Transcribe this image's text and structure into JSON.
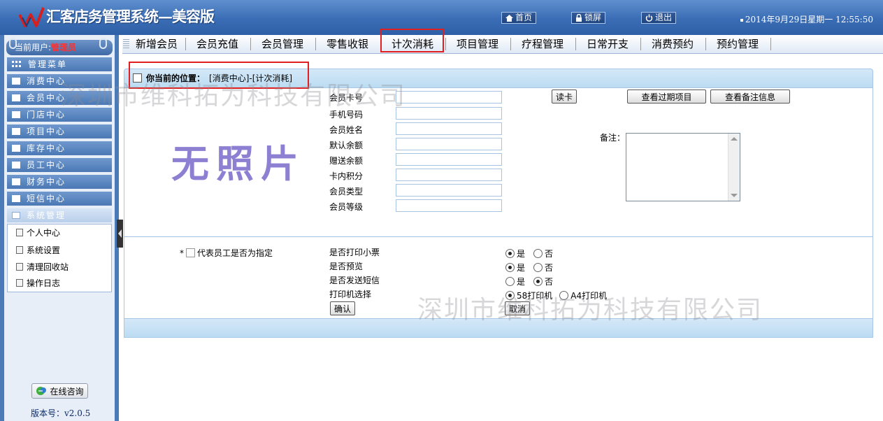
{
  "app": {
    "title": "汇客店务管理系统—美容版",
    "datetime": "2014年9月29日星期一  12:55:50"
  },
  "topbar": {
    "home_label": "首页",
    "lock_label": "锁屏",
    "logout_label": "退出"
  },
  "sidebar": {
    "user_prefix": "当前用户:",
    "user_name": "管理员",
    "menu_title": "管理菜单",
    "items": [
      "消费中心",
      "会员中心",
      "门店中心",
      "项目中心",
      "库存中心",
      "员工中心",
      "财务中心",
      "短信中心",
      "系统管理"
    ],
    "sub_items": [
      "个人中心",
      "系统设置",
      "清理回收站",
      "操作日志"
    ],
    "consult_label": "在线咨询",
    "version_label": "版本号：v2.0.5"
  },
  "nav": {
    "items": [
      "新增会员",
      "会员充值",
      "会员管理",
      "零售收银",
      "计次消耗",
      "项目管理",
      "疗程管理",
      "日常开支",
      "消费预约",
      "预约管理"
    ],
    "active_index": 4
  },
  "breadcrumb": {
    "prefix": "你当前的位置：",
    "path": "[消费中心]-[计次消耗]"
  },
  "photo": {
    "placeholder": "无照片"
  },
  "member": {
    "labels": [
      "会员卡号",
      "手机号码",
      "会员姓名",
      "默认余额",
      "赠送余额",
      "卡内积分",
      "会员类型",
      "会员等级"
    ],
    "values": [
      "",
      "",
      "",
      "",
      "",
      "",
      "",
      ""
    ],
    "read_card_label": "读卡",
    "view_expired_label": "查看过期项目",
    "view_remarks_label": "查看备注信息",
    "remarks_label": "备注：",
    "remarks_value": ""
  },
  "options": {
    "employee_required_mark": "*",
    "employee_label": "代表员工是否为指定",
    "print_receipt_label": "是否打印小票",
    "preview_label": "是否预览",
    "sms_label": "是否发送短信",
    "printer_label": "打印机选择",
    "yes_label": "是",
    "no_label": "否",
    "print_receipt_value": "是",
    "preview_value": "是",
    "sms_value": "否",
    "printer_58_label": "58打印机",
    "printer_a4_label": "A4打印机",
    "printer_value": "58打印机",
    "confirm_label": "确认",
    "cancel_label": "取消"
  },
  "watermark": {
    "text": "深圳市维科拓为科技有限公司"
  },
  "colors": {
    "topbar": "#3a6db5",
    "sidebar_item": "#4b79b5",
    "highlight_box": "#e02020",
    "band": "#c8e2f5",
    "photo_text": "#8d7fd1",
    "admin_text": "#ff3030"
  }
}
